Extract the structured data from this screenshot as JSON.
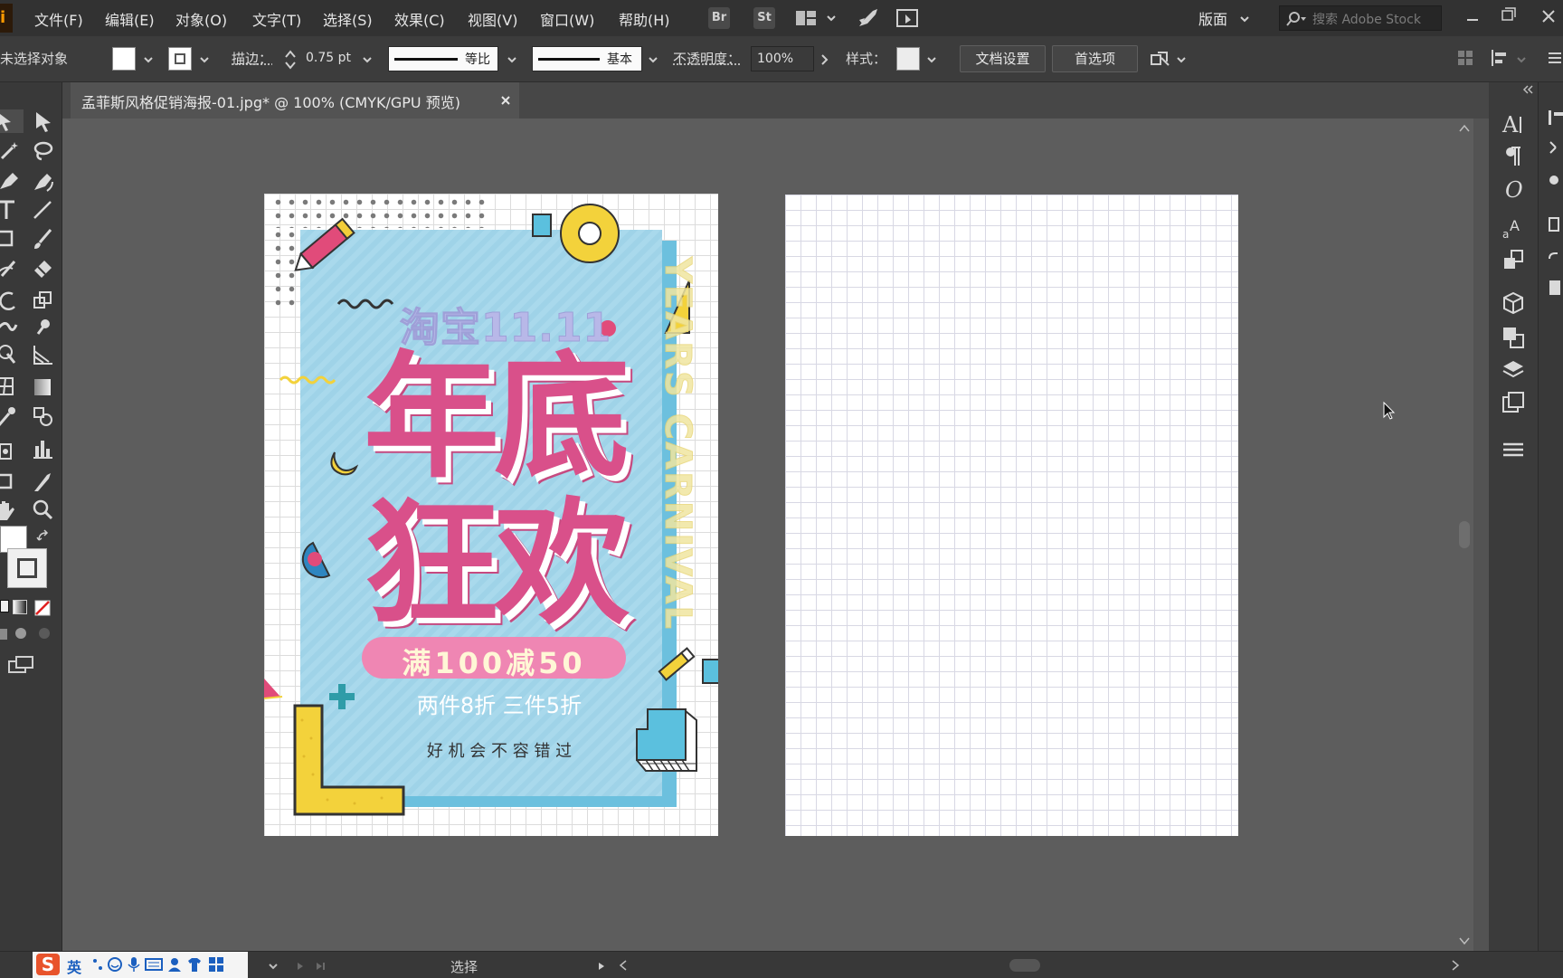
{
  "menu": {
    "items": [
      "文件(F)",
      "编辑(E)",
      "对象(O)",
      "文字(T)",
      "选择(S)",
      "效果(C)",
      "视图(V)",
      "窗口(W)",
      "帮助(H)"
    ],
    "bridge_label": "Br",
    "stock_label": "St",
    "workspace_label": "版面",
    "search_placeholder": "搜索 Adobe Stock"
  },
  "control": {
    "no_selection": "未选择对象",
    "stroke_label": "描边：",
    "stroke_weight": "0.75 pt",
    "profile_uniform": "等比",
    "brush_basic": "基本",
    "opacity_label": "不透明度：",
    "opacity_value": "100%",
    "style_label": "样式：",
    "doc_setup": "文档设置",
    "preferences": "首选项"
  },
  "tab": {
    "title": "孟菲斯风格促销海报-01.jpg* @ 100% (CMYK/GPU 预览)"
  },
  "poster": {
    "subtitle": "淘宝11.11",
    "title_line1": "年底",
    "title_line2": "狂欢",
    "side_text": "YEARS CARNIVAL",
    "badge": "满100减50",
    "deal": "两件8折 三件5折",
    "tagline": "好 机 会 不 容 错 过"
  },
  "status": {
    "mode_label": "选择",
    "ime_label": "英"
  },
  "colors": {
    "pink": "#d9508a",
    "light_blue": "#a8d8ea",
    "yellow": "#f3d23b",
    "dark_ui": "#323232"
  }
}
